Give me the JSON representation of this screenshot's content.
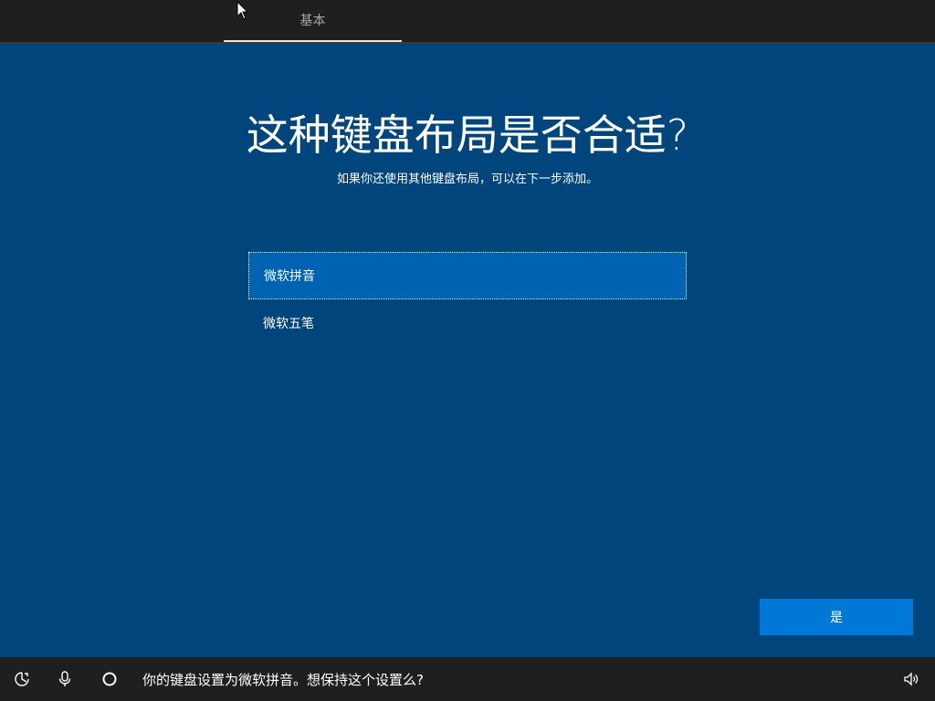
{
  "header": {
    "tab_label": "基本"
  },
  "main": {
    "title": "这种键盘布局是否合适?",
    "subtitle": "如果你还使用其他键盘布局，可以在下一步添加。",
    "options": [
      {
        "label": "微软拼音",
        "selected": true
      },
      {
        "label": "微软五笔",
        "selected": false
      }
    ],
    "yes_button_label": "是"
  },
  "bottom_bar": {
    "status_text": "你的键盘设置为微软拼音。想保持这个设置么?",
    "icons": [
      "ease-of-access-icon",
      "microphone-icon",
      "cortana-icon",
      "volume-icon"
    ]
  },
  "colors": {
    "background": "#00457c",
    "bar": "#1f1f1f",
    "selected_option": "#0063b1",
    "button": "#0078d7"
  }
}
